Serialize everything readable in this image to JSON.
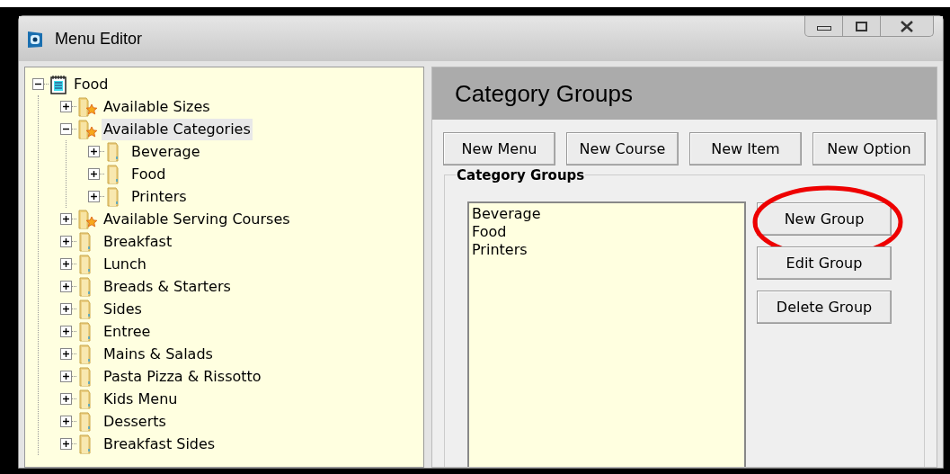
{
  "window": {
    "title": "Menu Editor"
  },
  "tree": [
    {
      "label": "Food",
      "kind": "notepad",
      "expanded": true,
      "selected": false,
      "children": [
        {
          "label": "Available Sizes",
          "kind": "star_folder",
          "expanded": false,
          "selected": false
        },
        {
          "label": "Available Categories",
          "kind": "star_folder",
          "expanded": true,
          "selected": true,
          "children": [
            {
              "label": "Beverage",
              "kind": "folder",
              "expanded": false,
              "selected": false
            },
            {
              "label": "Food",
              "kind": "folder",
              "expanded": false,
              "selected": false
            },
            {
              "label": "Printers",
              "kind": "folder",
              "expanded": false,
              "selected": false
            }
          ]
        },
        {
          "label": "Available Serving Courses",
          "kind": "star_folder",
          "expanded": false,
          "selected": false
        },
        {
          "label": "Breakfast",
          "kind": "folder",
          "expanded": false,
          "selected": false
        },
        {
          "label": "Lunch",
          "kind": "folder",
          "expanded": false,
          "selected": false
        },
        {
          "label": "Breads & Starters",
          "kind": "folder",
          "expanded": false,
          "selected": false
        },
        {
          "label": "Sides",
          "kind": "folder",
          "expanded": false,
          "selected": false
        },
        {
          "label": "Entree",
          "kind": "folder",
          "expanded": false,
          "selected": false
        },
        {
          "label": "Mains & Salads",
          "kind": "folder",
          "expanded": false,
          "selected": false
        },
        {
          "label": "Pasta Pizza & Rissotto",
          "kind": "folder",
          "expanded": false,
          "selected": false
        },
        {
          "label": "Kids Menu",
          "kind": "folder",
          "expanded": false,
          "selected": false
        },
        {
          "label": "Desserts",
          "kind": "folder",
          "expanded": false,
          "selected": false
        },
        {
          "label": "Breakfast Sides",
          "kind": "folder",
          "expanded": false,
          "selected": false
        }
      ]
    }
  ],
  "panel": {
    "title": "Category Groups",
    "toolbar": [
      "New Menu",
      "New Course",
      "New Item",
      "New Option"
    ],
    "group": {
      "title": "Category Groups",
      "list": [
        "Beverage",
        "Food",
        "Printers"
      ],
      "buttons": [
        {
          "label": "New Group",
          "circled": true
        },
        {
          "label": "Edit Group",
          "circled": false
        },
        {
          "label": "Delete Group",
          "circled": false
        }
      ]
    }
  }
}
